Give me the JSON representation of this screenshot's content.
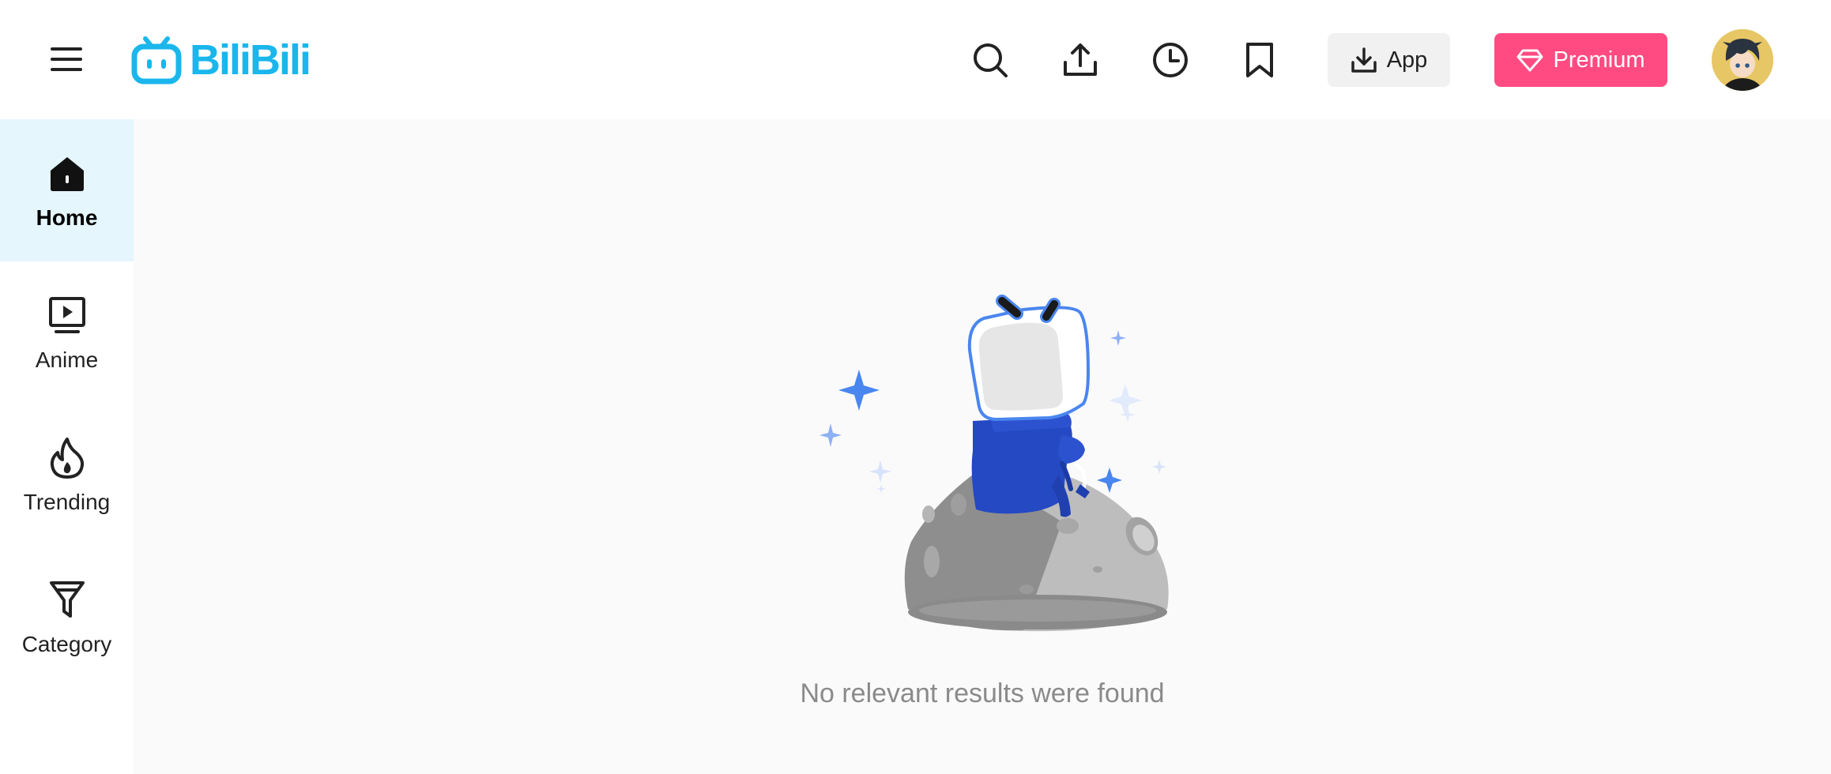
{
  "header": {
    "logo_text": "BiliBili",
    "app_button_label": "App",
    "premium_button_label": "Premium"
  },
  "sidebar": {
    "items": [
      {
        "label": "Home",
        "icon": "home-icon",
        "active": true
      },
      {
        "label": "Anime",
        "icon": "play-screen-icon",
        "active": false
      },
      {
        "label": "Trending",
        "icon": "flame-icon",
        "active": false
      },
      {
        "label": "Category",
        "icon": "filter-icon",
        "active": false
      }
    ]
  },
  "main": {
    "empty_message": "No relevant results were found"
  },
  "colors": {
    "brand_blue": "#1ab6ec",
    "premium_pink": "#ff4b82",
    "active_bg": "#e5f6fd"
  }
}
